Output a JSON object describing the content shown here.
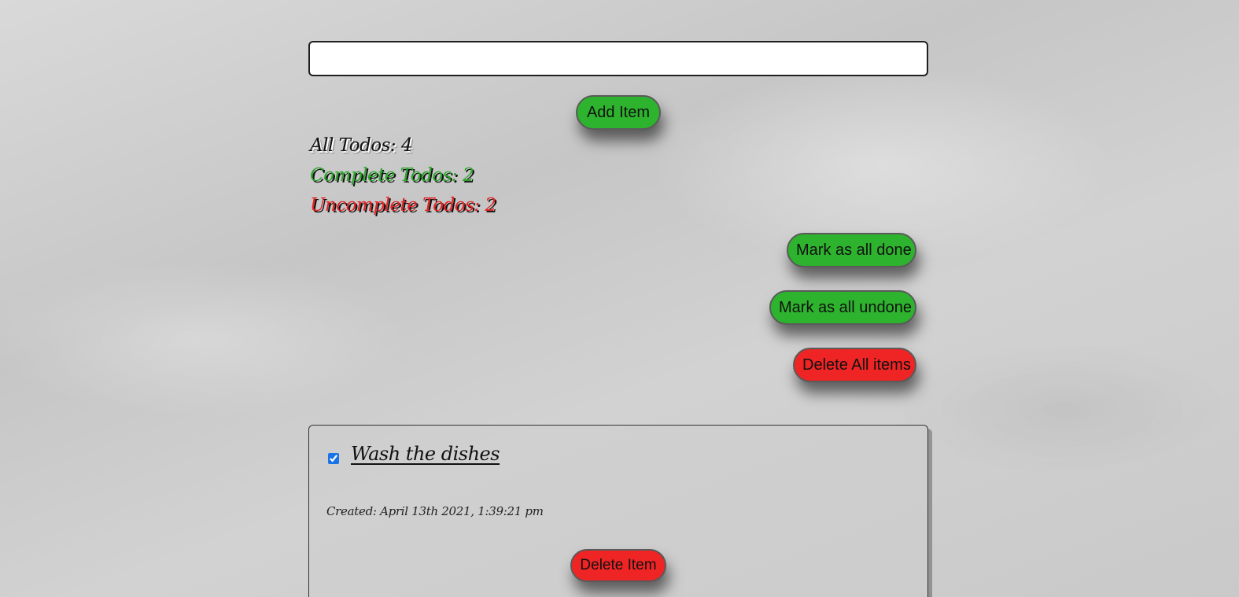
{
  "new_todo": {
    "value": "",
    "placeholder": ""
  },
  "buttons": {
    "add_item": "Add Item",
    "mark_all_done": "Mark as all done",
    "mark_all_undone": "Mark as all undone",
    "delete_all": "Delete All items"
  },
  "stats": {
    "all": "All Todos: 4",
    "complete": "Complete Todos: 2",
    "uncomplete": "Uncomplete Todos: 2"
  },
  "todos": [
    {
      "title": "Wash the dishes",
      "checked": true,
      "created": "Created: April 13th 2021, 1:39:21 pm",
      "delete_label": "Delete Item"
    }
  ],
  "colors": {
    "green_button": "#2db32d",
    "red_button": "#ef2424",
    "complete_text": "#2aa52a",
    "uncomplete_text": "#e42222"
  }
}
